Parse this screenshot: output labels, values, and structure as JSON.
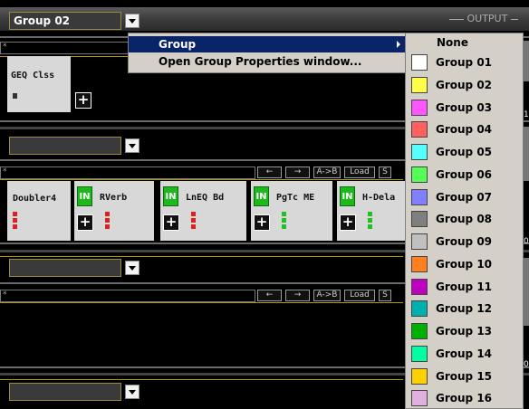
{
  "group_selector": {
    "value": "Group 02"
  },
  "output_label": "OUTPUT",
  "star": "*",
  "context_menu": {
    "items": [
      {
        "label": "Group",
        "highlighted": true,
        "has_submenu": true
      },
      {
        "label": "Open Group Properties window...",
        "highlighted": false,
        "has_submenu": false
      }
    ]
  },
  "group_submenu": {
    "none_label": "None",
    "items": [
      {
        "label": "Group 01",
        "color": "#ffffff"
      },
      {
        "label": "Group 02",
        "color": "#ffff4a"
      },
      {
        "label": "Group 03",
        "color": "#ff55ff"
      },
      {
        "label": "Group 04",
        "color": "#ff6060"
      },
      {
        "label": "Group 05",
        "color": "#55ffff"
      },
      {
        "label": "Group 06",
        "color": "#55ff55"
      },
      {
        "label": "Group 07",
        "color": "#7f7fff"
      },
      {
        "label": "Group 08",
        "color": "#7f7f7f"
      },
      {
        "label": "Group 09",
        "color": "#c0c0c0"
      },
      {
        "label": "Group 10",
        "color": "#ff8020"
      },
      {
        "label": "Group 11",
        "color": "#c000c0"
      },
      {
        "label": "Group 12",
        "color": "#00b0b0"
      },
      {
        "label": "Group 13",
        "color": "#00b000"
      },
      {
        "label": "Group 14",
        "color": "#00ffa0"
      },
      {
        "label": "Group 15",
        "color": "#ffd000"
      },
      {
        "label": "Group 16",
        "color": "#e0b0e0"
      }
    ]
  },
  "rack_toolbar": {
    "left_arrow": "←",
    "right_arrow": "→",
    "ab_label": "A->B",
    "load_label": "Load",
    "save_label": "S"
  },
  "top_rack": {
    "plugin_name": "GEQ Clss"
  },
  "middle_rack": {
    "first_plugin": "Doubler4",
    "plugins": [
      {
        "in_label": "IN",
        "name": "RVerb"
      },
      {
        "in_label": "IN",
        "name": "LnEQ Bd"
      },
      {
        "in_label": "IN",
        "name": "PgTc ME"
      },
      {
        "in_label": "IN",
        "name": "H-Dela"
      }
    ]
  },
  "plus_label": "+",
  "edge_digits": [
    "1",
    "0",
    "0"
  ]
}
